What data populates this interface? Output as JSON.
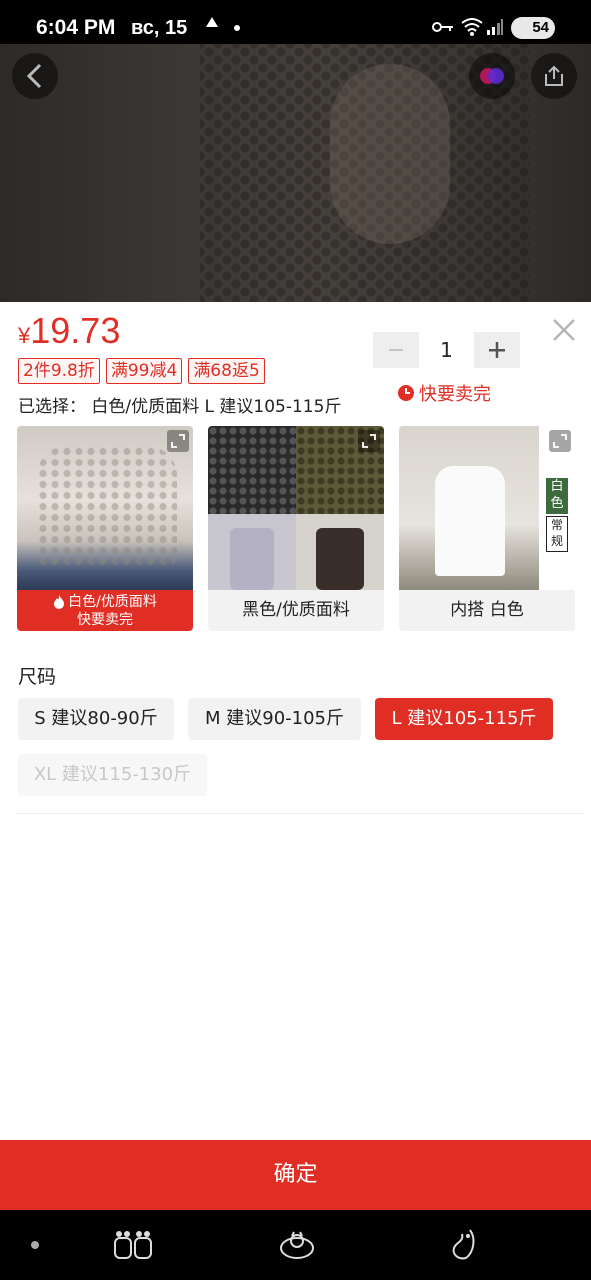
{
  "status_bar": {
    "time": "6:04 PM",
    "date": "вс, 15",
    "battery": "54"
  },
  "product": {
    "currency": "¥",
    "price": "19.73",
    "promo_tags": [
      "2件9.8折",
      "满99减4",
      "满68返5"
    ],
    "selected_text": "已选择： 白色/优质面料 L 建议105-115斤",
    "quantity": "1",
    "hurry_text": "快要卖完"
  },
  "variants": [
    {
      "label_line1": "白色/优质面料",
      "label_line2": "快要卖完",
      "selected": true
    },
    {
      "label": "黑色/优质面料",
      "selected": false
    },
    {
      "label": "内搭 白色",
      "side_tag_1": "白色",
      "side_tag_2": "常规",
      "selected": false
    }
  ],
  "size": {
    "title": "尺码",
    "options": [
      {
        "label": "S 建议80-90斤",
        "state": "normal"
      },
      {
        "label": "M 建议90-105斤",
        "state": "normal"
      },
      {
        "label": "L 建议105-115斤",
        "state": "selected"
      },
      {
        "label": "XL 建议115-130斤",
        "state": "disabled"
      }
    ]
  },
  "confirm_label": "确定",
  "colors": {
    "accent": "#e02e24",
    "chip_bg": "#f2f2f2",
    "text": "#222222"
  },
  "icons": [
    "back-icon",
    "share-icon",
    "close-icon",
    "minus-icon",
    "plus-icon",
    "clock-icon",
    "flame-icon",
    "expand-icon"
  ]
}
